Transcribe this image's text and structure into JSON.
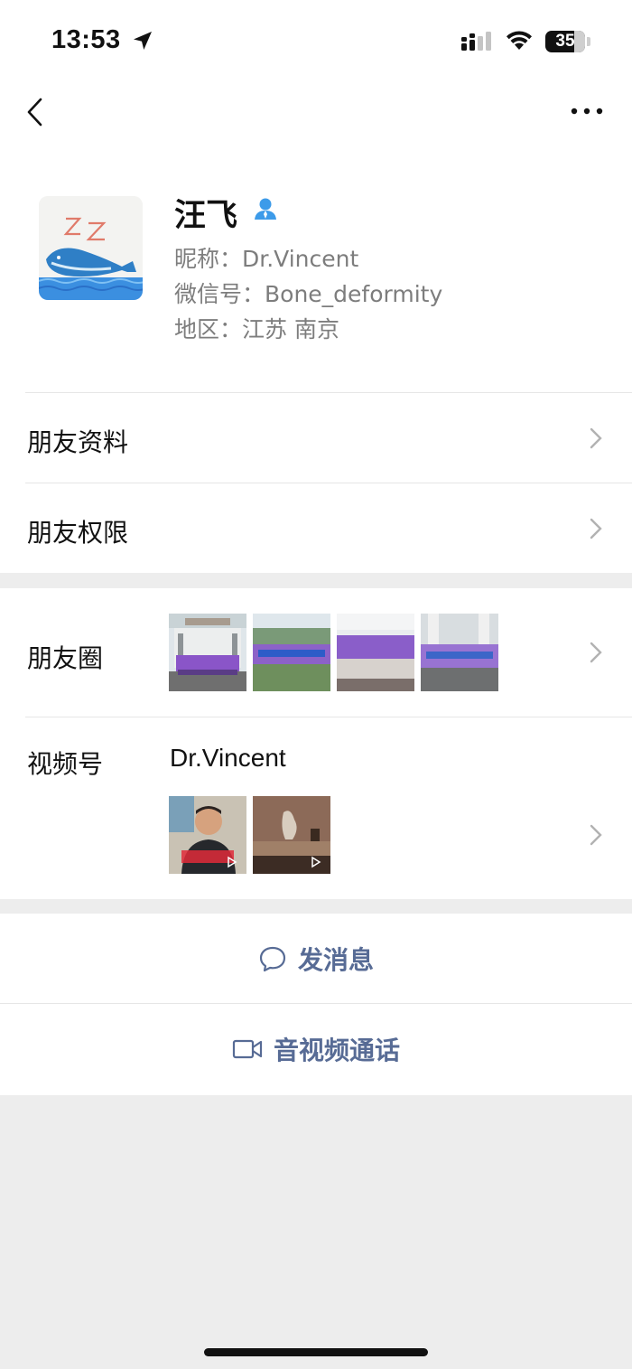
{
  "status_bar": {
    "time": "13:53",
    "battery": "35"
  },
  "profile": {
    "name": "汪飞",
    "nickname": "昵称：Dr.Vincent",
    "wechat_id": "微信号：Bone_deformity",
    "region": "地区：江苏 南京"
  },
  "menu": {
    "friend_info": "朋友资料",
    "friend_permissions": "朋友权限",
    "moments": "朋友圈",
    "channels": "视频号",
    "channels_name": "Dr.Vincent"
  },
  "actions": {
    "send_message": "发消息",
    "video_call": "音视频通话"
  },
  "colors": {
    "link": "#576b95",
    "page_bg": "#ededed",
    "badge": "#3d9be9"
  }
}
